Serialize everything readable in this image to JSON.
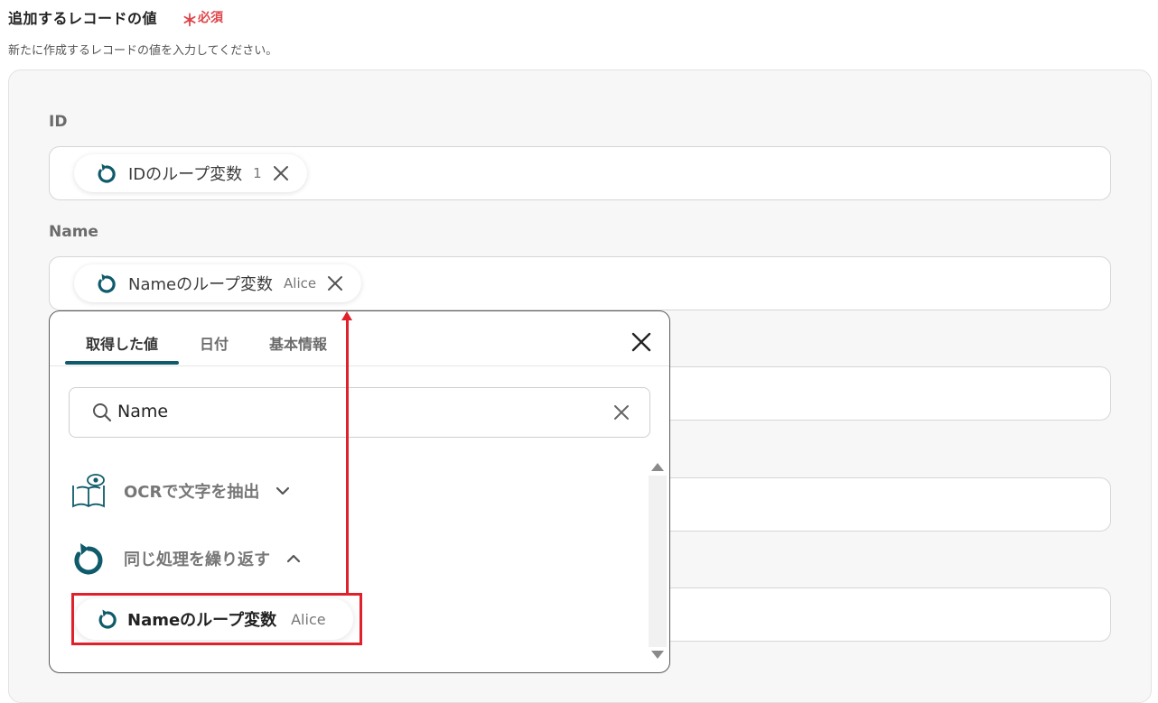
{
  "section": {
    "title": "追加するレコードの値",
    "required_star": "＊",
    "required_label": "必須",
    "description": "新たに作成するレコードの値を入力してください。"
  },
  "fields": [
    {
      "label": "ID",
      "chip": {
        "name": "IDのループ変数",
        "value": "1"
      }
    },
    {
      "label": "Name",
      "chip": {
        "name": "Nameのループ変数",
        "value": "Alice"
      }
    }
  ],
  "popup": {
    "tabs": [
      "取得した値",
      "日付",
      "基本情報"
    ],
    "active_tab": "取得した値",
    "search": {
      "value": "Name"
    },
    "groups": [
      {
        "label": "OCRで文字を抽出",
        "icon": "book-eye-icon",
        "expanded": false
      },
      {
        "label": "同じ処理を繰り返す",
        "icon": "loop-icon",
        "expanded": true
      }
    ],
    "result": {
      "name": "Nameのループ変数",
      "value": "Alice"
    }
  },
  "colors": {
    "accent": "#0f5b6b",
    "required": "#e0454a",
    "annotation": "#e0202a"
  }
}
